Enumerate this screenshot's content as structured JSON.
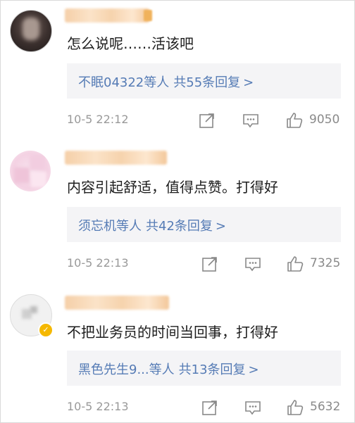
{
  "comments": [
    {
      "text": "怎么说呢……活该吧",
      "reply_users": "不眠04322",
      "reply_suffix": "等人",
      "reply_count": "共55条回复",
      "chevron": ">",
      "time": "10-5 22:12",
      "likes": "9050"
    },
    {
      "text": "内容引起舒适，值得点赞。打得好",
      "reply_users": "须忘机",
      "reply_suffix": "等人",
      "reply_count": "共42条回复",
      "chevron": ">",
      "time": "10-5 22:13",
      "likes": "7325"
    },
    {
      "text": "不把业务员的时间当回事，打得好",
      "reply_users": "黑色先生9...",
      "reply_suffix": "等人",
      "reply_count": "共13条回复",
      "chevron": ">",
      "time": "10-5 22:13",
      "likes": "5632"
    }
  ],
  "icons": [
    "share-icon",
    "comment-icon",
    "thumbs-up-icon"
  ],
  "colors": {
    "link": "#557bb5",
    "meta": "#999999",
    "reply_bg": "#f4f4f6"
  }
}
